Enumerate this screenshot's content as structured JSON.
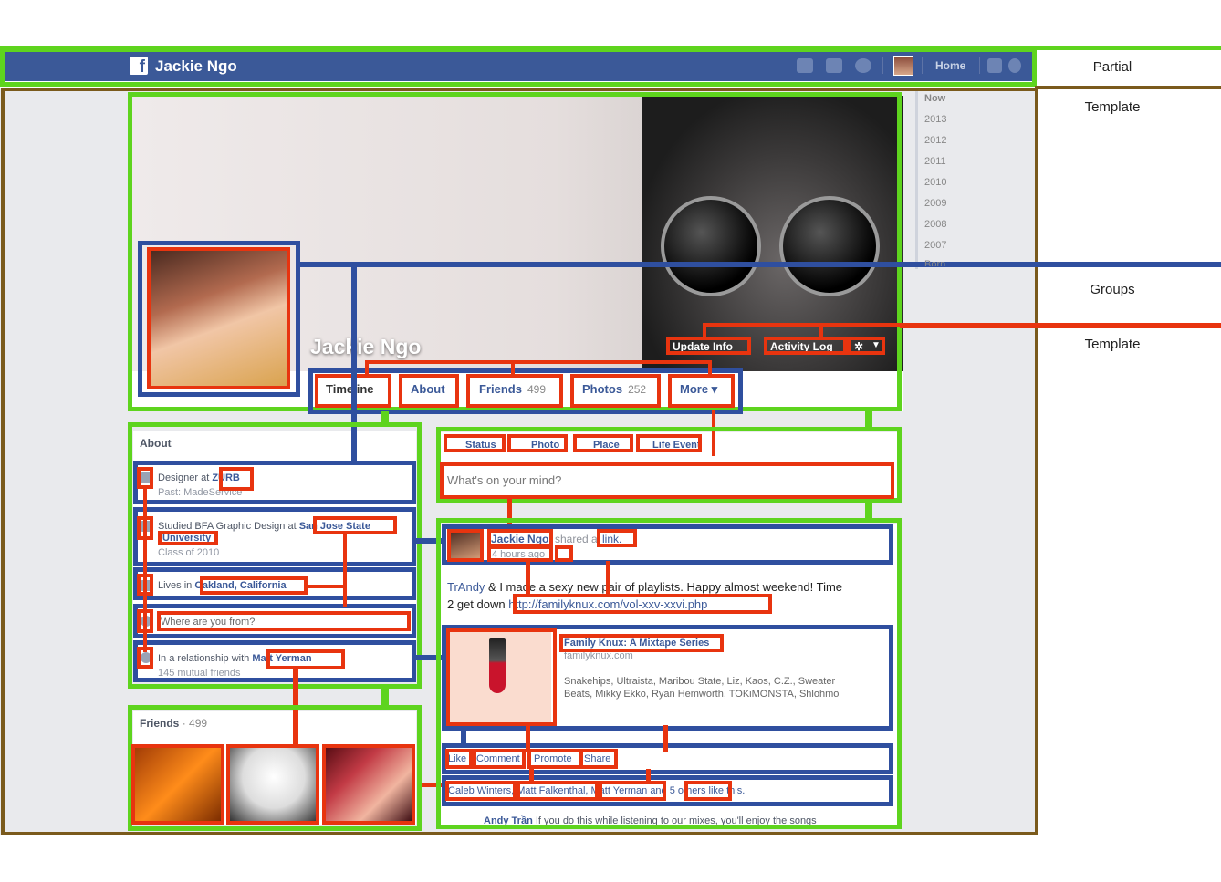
{
  "topbar": {
    "name": "Jackie Ngo",
    "home_label": "Home",
    "icons": [
      "friends-icon",
      "messages-icon",
      "notifications-icon",
      "privacy-icon",
      "settings-icon"
    ]
  },
  "side_labels": {
    "partial": "Partial",
    "template_top": "Template",
    "groups": "Groups",
    "template_bottom": "Template"
  },
  "years": [
    "Now",
    "2013",
    "2012",
    "2011",
    "2010",
    "2009",
    "2008",
    "2007",
    "Born"
  ],
  "cover": {
    "name": "Jackie Ngo",
    "update_info": "Update Info",
    "activity_log": "Activity Log"
  },
  "nav": [
    {
      "label": "Timeline",
      "count": ""
    },
    {
      "label": "About",
      "count": ""
    },
    {
      "label": "Friends",
      "count": "499"
    },
    {
      "label": "Photos",
      "count": "252"
    },
    {
      "label": "More ▾",
      "count": ""
    }
  ],
  "about": {
    "title": "About",
    "work_prefix": "Designer at ",
    "work_link": "ZURB",
    "work_past": "Past: MadeService",
    "edu_prefix": "Studied BFA Graphic Design at ",
    "edu_link": "San Jose State",
    "edu_link2": "University",
    "edu_class": "Class of 2010",
    "lives_prefix": "Lives in ",
    "lives_link": "Oakland, California",
    "from_placeholder": "Where are you from?",
    "rel_prefix": "In a relationship with ",
    "rel_link": "Matt Yerman",
    "rel_mutual": "145 mutual friends"
  },
  "friends": {
    "title": "Friends",
    "count": "· 499"
  },
  "composer": {
    "status": "Status",
    "photo": "Photo",
    "place": "Place",
    "life_event": "Life Event",
    "placeholder": "What's on your mind?"
  },
  "story": {
    "author": "Jackie Ngo",
    "shared": "shared a",
    "link_word": "link.",
    "time": "4 hours ago",
    "text_part1": "TrAndy",
    "text_part2": " & I made a sexy new pair of playlists. Happy almost weekend! Time",
    "text_line2": "2 get down ",
    "url": "http://familyknux.com/vol-xxv-xxvi.php",
    "att_title": "Family Knux: A Mixtape Series",
    "att_domain": "familyknux.com",
    "att_desc1": "Snakehips, Ultraista, Maribou State, Liz, Kaos, C.Z., Sweater",
    "att_desc2": "Beats, Mikky Ekko, Ryan Hemworth, TOKiMONSTA, Shlohmo",
    "actions": [
      "Like",
      "Comment",
      "Promote",
      "Share"
    ],
    "likers": "Caleb Winters, Matt Falkenthal, Matt Yerman and 5 others like this.",
    "comment_author": "Andy Trần",
    "comment_text": "If you do this while listening to our mixes, you'll enjoy the songs"
  }
}
